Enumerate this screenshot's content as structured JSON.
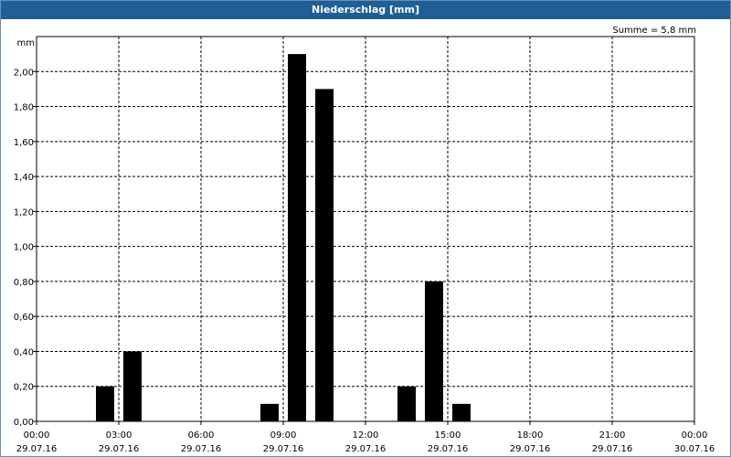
{
  "window": {
    "title": "Niederschlag [mm]"
  },
  "chart_data": {
    "type": "bar",
    "title": "Niederschlag [mm]",
    "ylabel": "mm",
    "summary": "Summe = 5,8 mm",
    "ylim": [
      0,
      2.2
    ],
    "y_ticks": [
      "0,00",
      "0,20",
      "0,40",
      "0,60",
      "0,80",
      "1,00",
      "1,20",
      "1,40",
      "1,60",
      "1,80",
      "2,00"
    ],
    "x_ticks": [
      {
        "time": "00:00",
        "date": "29.07.16"
      },
      {
        "time": "03:00",
        "date": "29.07.16"
      },
      {
        "time": "06:00",
        "date": "29.07.16"
      },
      {
        "time": "09:00",
        "date": "29.07.16"
      },
      {
        "time": "12:00",
        "date": "29.07.16"
      },
      {
        "time": "15:00",
        "date": "29.07.16"
      },
      {
        "time": "18:00",
        "date": "29.07.16"
      },
      {
        "time": "21:00",
        "date": "29.07.16"
      },
      {
        "time": "00:00",
        "date": "30.07.16"
      }
    ],
    "bars": [
      {
        "hour": 2,
        "value": 0.2
      },
      {
        "hour": 3,
        "value": 0.4
      },
      {
        "hour": 8,
        "value": 0.1
      },
      {
        "hour": 9,
        "value": 2.1
      },
      {
        "hour": 10,
        "value": 1.9
      },
      {
        "hour": 13,
        "value": 0.2
      },
      {
        "hour": 14,
        "value": 0.8
      },
      {
        "hour": 15,
        "value": 0.1
      }
    ],
    "grid": true,
    "bar_color": "#000000"
  }
}
